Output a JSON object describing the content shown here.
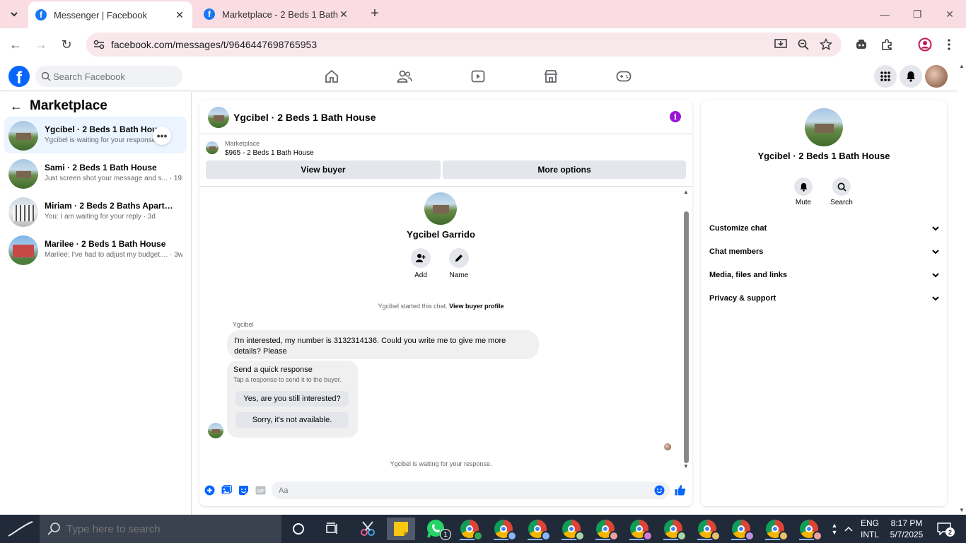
{
  "browser": {
    "tabs": [
      {
        "title": "Messenger | Facebook",
        "active": true
      },
      {
        "title": "Marketplace - 2 Beds 1 Bath Ho",
        "active": false
      }
    ],
    "url": "facebook.com/messages/t/9646447698765953"
  },
  "fb": {
    "search_placeholder": "Search Facebook"
  },
  "left": {
    "title": "Marketplace",
    "conversations": [
      {
        "name": "Ygcibel · 2 Beds 1 Bath House",
        "snippet": "Ygcibel is waiting for your response.",
        "time": "",
        "thumb": "house-green",
        "selected": true
      },
      {
        "name": "Sami · 2 Beds 1 Bath House",
        "snippet": "Just screen shot your message and s... · 19h",
        "time": "19h",
        "thumb": "house-green",
        "selected": false
      },
      {
        "name": "Miriam · 2 Beds 2 Baths Apartmen...",
        "snippet": "You: I am waiting for your reply · 3d",
        "time": "3d",
        "thumb": "house-white",
        "selected": false
      },
      {
        "name": "Marilee · 2 Beds 1 Bath House",
        "snippet": "Marilee: I've had to adjust my budget.... · 3w",
        "time": "3w",
        "thumb": "house-red",
        "selected": false
      }
    ]
  },
  "chat": {
    "title": "Ygcibel · 2 Beds 1 Bath House",
    "marketplace_label": "Marketplace",
    "listing": "$965 - 2 Beds 1 Bath House",
    "view_buyer": "View buyer",
    "more_options": "More options",
    "profile_name": "Ygcibel Garrido",
    "add_label": "Add",
    "name_label": "Name",
    "started_text": "Ygcibel started this chat.",
    "view_profile": "View buyer profile",
    "sender": "Ygcibel",
    "message": "I'm interested, my number is 3132314136. Could you write me to give me more details? Please",
    "quick_title": "Send a quick response",
    "quick_sub": "Tap a response to send it to the buyer.",
    "quick_replies": [
      "Yes, are you still interested?",
      "Sorry, it's not available."
    ],
    "waiting": "Ygcibel is waiting for your response.",
    "composer_placeholder": "Aa",
    "accent": "#0866ff"
  },
  "right": {
    "name": "Ygcibel · 2 Beds 1 Bath House",
    "mute": "Mute",
    "search": "Search",
    "sections": [
      "Customize chat",
      "Chat members",
      "Media, files and links",
      "Privacy & support"
    ]
  },
  "taskbar": {
    "search_placeholder": "Type here to search",
    "lang_top": "ENG",
    "lang_bottom": "INTL",
    "time": "8:17 PM",
    "date": "5/7/2025",
    "notif_count": "2",
    "whatsapp_badge": "1"
  }
}
